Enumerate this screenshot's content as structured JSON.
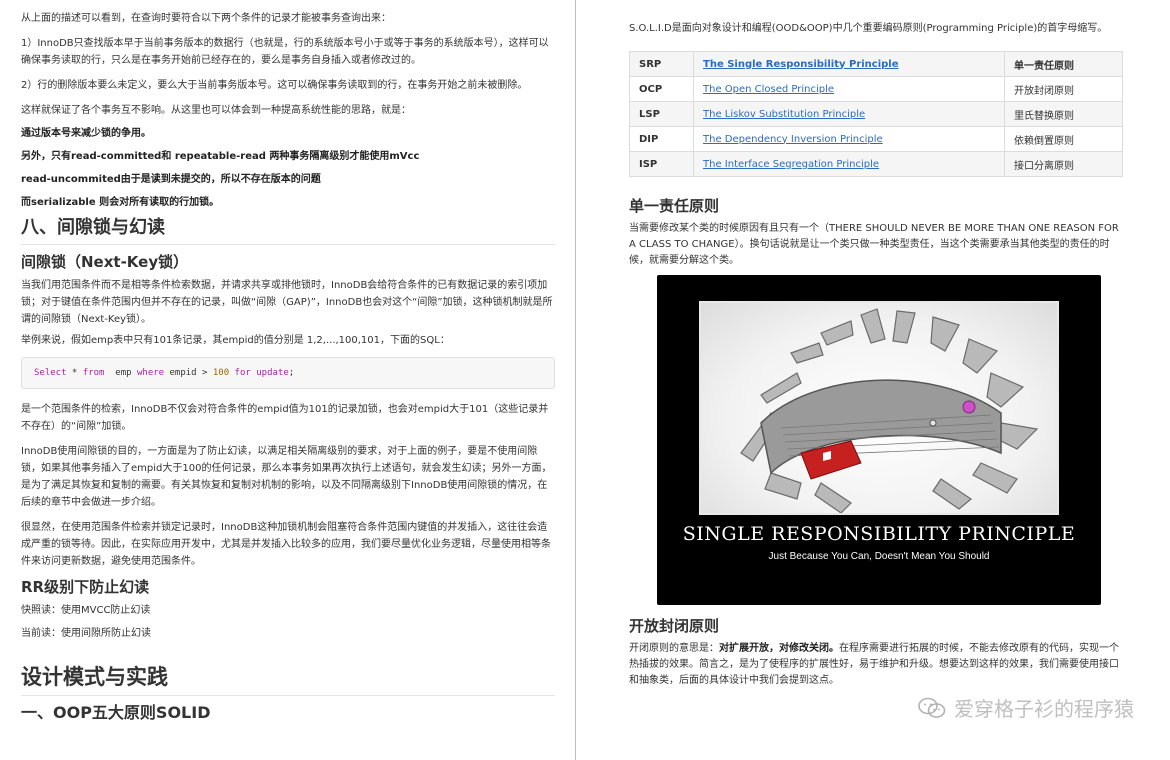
{
  "left": {
    "intro": "从上面的描述可以看到，在查询时要符合以下两个条件的记录才能被事务查询出来：",
    "cond1": "1）InnoDB只查找版本早于当前事务版本的数据行（也就是，行的系统版本号小于或等于事务的系统版本号），这样可以确保事务读取的行，只么是在事务开始前已经存在的，要么是事务自身插入或者修改过的。",
    "cond2": "2）行的删除版本要么未定义，要么大于当前事务版本号。这可以确保事务读取到的行，在事务开始之前未被删除。",
    "summary": "这样就保证了各个事务互不影响。从这里也可以体会到一种提高系统性能的思路，就是：",
    "bold1": "通过版本号来减少锁的争用。",
    "bold2": "另外，只有read-committed和 repeatable-read 两种事务隔离级别才能使用mVcc",
    "bold3": "read-uncommited由于是读到未提交的，所以不存在版本的问题",
    "bold4": "而serializable 则会对所有读取的行加锁。",
    "h_section8": "八、间隙锁与幻读",
    "h_gaplock": "间隙锁（Next-Key锁）",
    "gap_p1": "当我们用范围条件而不是相等条件检索数据，并请求共享或排他锁时，InnoDB会给符合条件的已有数据记录的索引项加锁；对于键值在条件范围内但并不存在的记录，叫做“间隙（GAP)”，InnoDB也会对这个“间隙”加锁，这种锁机制就是所谓的间隙锁（Next-Key锁）。",
    "gap_p2": "举例来说，假如emp表中只有101条记录，其empid的值分别是 1,2,...,100,101，下面的SQL：",
    "code": {
      "select": "Select",
      "star": " * ",
      "from": "from",
      "table": "  emp ",
      "where": "where",
      "col": " empid > ",
      "value": "100",
      "sp": " ",
      "for": "for",
      "sp2": " ",
      "update": "update",
      "end": ";"
    },
    "gap_p3": "是一个范围条件的检索，InnoDB不仅会对符合条件的empid值为101的记录加锁，也会对empid大于101（这些记录并不存在）的“间隙”加锁。",
    "gap_p4": "InnoDB使用间隙锁的目的，一方面是为了防止幻读，以满足相关隔离级别的要求，对于上面的例子，要是不使用间隙锁，如果其他事务插入了empid大于100的任何记录，那么本事务如果再次执行上述语句，就会发生幻读；另外一方面，是为了满足其恢复和复制的需要。有关其恢复和复制对机制的影响，以及不同隔离级别下InnoDB使用间隙锁的情况，在后续的章节中会做进一步介绍。",
    "gap_p5": "很显然，在使用范围条件检索并锁定记录时，InnoDB这种加锁机制会阻塞符合条件范围内键值的并发插入，这往往会造成严重的锁等待。因此，在实际应用开发中，尤其是并发插入比较多的应用，我们要尽量优化业务逻辑，尽量使用相等条件来访问更新数据，避免使用范围条件。",
    "h_rr": "RR级别下防止幻读",
    "snapshot": "快照读：使用MVCC防止幻读",
    "current": "当前读：使用间隙所防止幻读",
    "h_design": "设计模式与实践",
    "h_oop": "一、OOP五大原则SOLID"
  },
  "right": {
    "intro": "S.O.L.I.D是面向对象设计和编程(OOD&OOP)中几个重要编码原则(Programming Priciple)的首字母缩写。",
    "table": [
      {
        "abbr": "SRP",
        "name": "The Single Responsibility Principle ",
        "cn": "单一责任原则"
      },
      {
        "abbr": "OCP",
        "name": "The Open Closed Principle",
        "cn": "开放封闭原则"
      },
      {
        "abbr": "LSP",
        "name": "The Liskov Substitution Principle",
        "cn": "里氏替换原则"
      },
      {
        "abbr": "DIP",
        "name": "The Dependency Inversion Principle",
        "cn": "依赖倒置原则"
      },
      {
        "abbr": "ISP",
        "name": "The Interface Segregation Principle",
        "cn": "接口分离原则"
      }
    ],
    "h_srp": "单一责任原则",
    "srp_p": "当需要修改某个类的时候原因有且只有一个（THERE SHOULD NEVER BE MORE THAN ONE REASON FOR A CLASS TO CHANGE）。换句话说就是让一个类只做一种类型责任，当这个类需要承当其他类型的责任的时候，就需要分解这个类。",
    "poster_title": "SINGLE RESPONSIBILITY PRINCIPLE",
    "poster_sub": "Just Because You Can, Doesn't Mean You Should",
    "h_ocp": "开放封闭原则",
    "ocp_p_a": "开闭原则的意思是：",
    "ocp_p_bold": "对扩展开放，对修改关闭。",
    "ocp_p_b": "在程序需要进行拓展的时候，不能去修改原有的代码，实现一个热插拔的效果。简言之，是为了使程序的扩展性好，易于维护和升级。想要达到这样的效果，我们需要使用接口和抽象类，后面的具体设计中我们会提到这点。",
    "watermark": "爱穿格子衫的程序猿"
  }
}
